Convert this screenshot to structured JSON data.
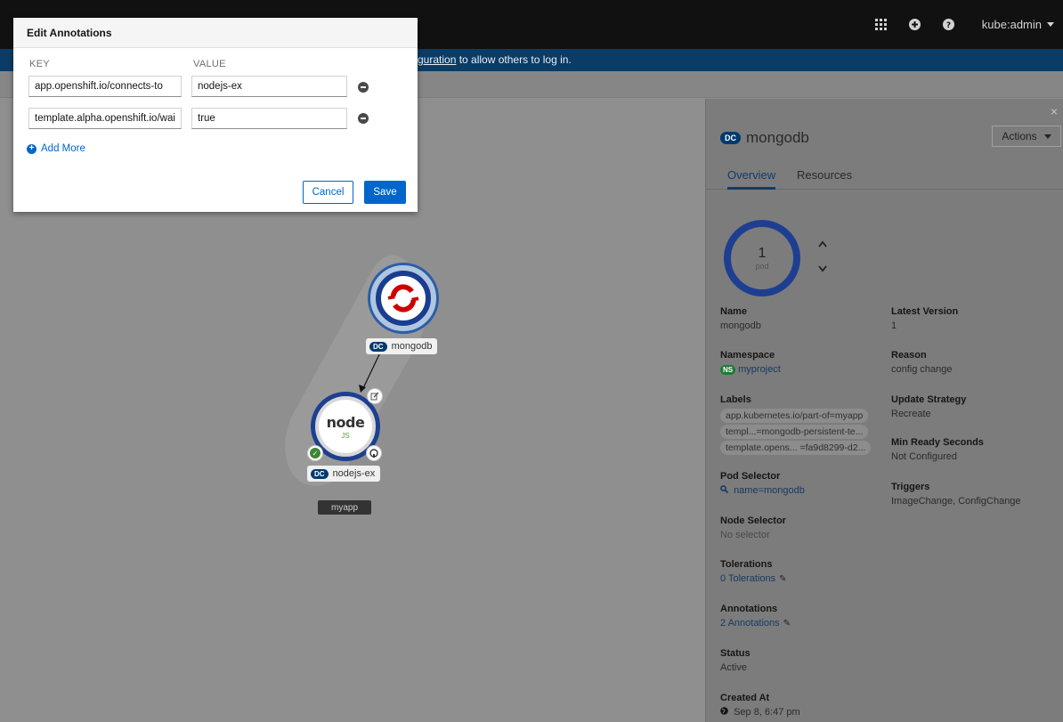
{
  "masthead": {
    "username": "kube:admin",
    "icons": [
      "grid-icon",
      "plus-circle-icon",
      "help-icon"
    ]
  },
  "banner": {
    "link_text": "guration",
    "rest_text": " to allow others to log in."
  },
  "modal": {
    "title": "Edit Annotations",
    "key_header": "KEY",
    "value_header": "VALUE",
    "rows": [
      {
        "key": "app.openshift.io/connects-to",
        "value": "nodejs-ex"
      },
      {
        "key": "template.alpha.openshift.io/wai...",
        "value": "true"
      }
    ],
    "add_more_label": "Add More",
    "cancel_label": "Cancel",
    "save_label": "Save"
  },
  "topology": {
    "nodes": [
      {
        "badge": "DC",
        "name": "mongodb"
      },
      {
        "badge": "DC",
        "name": "nodejs-ex"
      }
    ],
    "node_logo_text": "node",
    "node_logo_sub": "JS",
    "app_group": "myapp"
  },
  "panel": {
    "close": "×",
    "badge": "DC",
    "title": "mongodb",
    "actions_label": "Actions",
    "tabs": [
      "Overview",
      "Resources"
    ],
    "pod_count": "1",
    "pod_unit": "pod",
    "left_fields": {
      "name_label": "Name",
      "name_value": "mongodb",
      "namespace_label": "Namespace",
      "namespace_badge": "NS",
      "namespace_value": "myproject",
      "labels_label": "Labels",
      "labels": [
        "app.kubernetes.io/part-of=myapp",
        "templ...=mongodb-persistent-te...",
        "template.opens... =fa9d8299-d2..."
      ],
      "pod_selector_label": "Pod Selector",
      "pod_selector_value": "name=mongodb",
      "node_selector_label": "Node Selector",
      "node_selector_value": "No selector",
      "tolerations_label": "Tolerations",
      "tolerations_value": "0 Tolerations",
      "annotations_label": "Annotations",
      "annotations_value": "2 Annotations",
      "status_label": "Status",
      "status_value": "Active",
      "created_label": "Created At",
      "created_value": "Sep 8, 6:47 pm"
    },
    "right_fields": {
      "latest_version_label": "Latest Version",
      "latest_version_value": "1",
      "reason_label": "Reason",
      "reason_value": "config change",
      "update_strategy_label": "Update Strategy",
      "update_strategy_value": "Recreate",
      "min_ready_label": "Min Ready Seconds",
      "min_ready_value": "Not Configured",
      "triggers_label": "Triggers",
      "triggers_value": "ImageChange, ConfigChange"
    }
  },
  "colors": {
    "primary_blue": "#0066cc",
    "node_ring": "#1e3f91",
    "openshift_red": "#cc0000",
    "node_green": "#539e43"
  }
}
